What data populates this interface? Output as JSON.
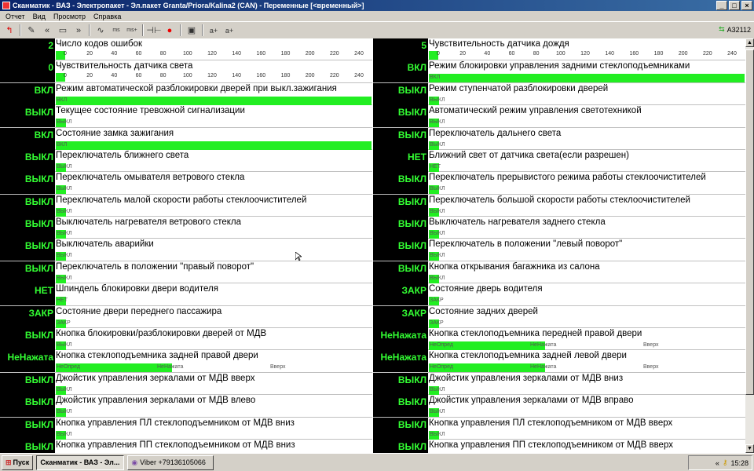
{
  "window": {
    "title": "Сканматик - ВАЗ - Электропакет - Эл.пакет Granta/Priora/Kalina2 (CAN) - Переменные [<временный>]",
    "min": "_",
    "max": "□",
    "close": "×"
  },
  "menu": [
    "Отчет",
    "Вид",
    "Просмотр",
    "Справка"
  ],
  "toolbar": {
    "zoom_small": "ms",
    "zoom_plus": "ms+",
    "a_minus": "a+",
    "a_plus": "a+",
    "adapter": "A32112"
  },
  "scale_ticks": [
    "0",
    "20",
    "40",
    "60",
    "80",
    "100",
    "120",
    "140",
    "160",
    "180",
    "200",
    "220",
    "240"
  ],
  "scale_max": 240,
  "left": [
    {
      "value": "2",
      "label": "Число кодов ошибок",
      "type": "scale"
    },
    {
      "value": "0",
      "label": "Чувствительность датчика света",
      "type": "scale"
    },
    {
      "value": "ВКЛ",
      "label": "Режим автоматической разблокировки дверей при выкл.зажигания",
      "type": "full",
      "bartext": "ВКЛ"
    },
    {
      "value": "ВЫКЛ",
      "label": "Текущее состояние тревожной сигнализации",
      "type": "small",
      "bartext": "ВЫКЛ"
    },
    {
      "value": "ВКЛ",
      "label": "Состояние замка зажигания",
      "type": "full",
      "bartext": "ВКЛ"
    },
    {
      "value": "ВЫКЛ",
      "label": "Переключатель ближнего света",
      "type": "small",
      "bartext": "ВЫКЛ"
    },
    {
      "value": "ВЫКЛ",
      "label": "Переключатель омывателя ветрового стекла",
      "type": "small",
      "bartext": "ВЫКЛ"
    },
    {
      "value": "ВЫКЛ",
      "label": "Переключатель малой скорости работы стеклоочистителей",
      "type": "small",
      "bartext": "ВЫКЛ"
    },
    {
      "value": "ВЫКЛ",
      "label": "Выключатель нагревателя ветрового стекла",
      "type": "small",
      "bartext": "ВЫКЛ"
    },
    {
      "value": "ВЫКЛ",
      "label": "Выключатель аварийки",
      "type": "small",
      "bartext": "ВЫКЛ"
    },
    {
      "value": "ВЫКЛ",
      "label": "Переключатель в положении \"правый поворот\"",
      "type": "small",
      "bartext": "ВЫКЛ"
    },
    {
      "value": "НЕТ",
      "label": "Шпиндель блокировки двери водителя",
      "type": "small",
      "bartext": "НЕТ"
    },
    {
      "value": "ЗАКР",
      "label": "Состояние двери переднего пассажира",
      "type": "small",
      "bartext": "ЗАКР"
    },
    {
      "value": "ВЫКЛ",
      "label": "Кнопка блокировки/разблокировки дверей от МДВ",
      "type": "small",
      "bartext": "ВЫКЛ"
    },
    {
      "value": "НеНажата",
      "label": "Кнопка стеклоподъемника задней правой двери",
      "type": "tri",
      "b1": "НеОпред",
      "b2": "НеНажата",
      "b3": "Вверх"
    },
    {
      "value": "ВЫКЛ",
      "label": "Джойстик управления зеркалами от МДВ вверх",
      "type": "small",
      "bartext": "ВЫКЛ"
    },
    {
      "value": "ВЫКЛ",
      "label": "Джойстик управления зеркалами от МДВ влево",
      "type": "small",
      "bartext": "ВЫКЛ"
    },
    {
      "value": "ВЫКЛ",
      "label": "Кнопка управления ПЛ стеклоподъемником от МДВ вниз",
      "type": "small",
      "bartext": "ВЫКЛ"
    },
    {
      "value": "ВЫКЛ",
      "label": "Кнопка управления ПП стеклоподъемником от МДВ вниз",
      "type": "small",
      "bartext": "ВЫКЛ"
    }
  ],
  "right": [
    {
      "value": "5",
      "label": "Чувствительность датчика дождя",
      "type": "scale"
    },
    {
      "value": "ВКЛ",
      "label": "Режим блокировки управления задними стеклоподъемниками",
      "type": "full",
      "bartext": "ВКЛ"
    },
    {
      "value": "ВЫКЛ",
      "label": "Режим ступенчатой разблокировки дверей",
      "type": "small",
      "bartext": "ВЫКЛ"
    },
    {
      "value": "ВЫКЛ",
      "label": "Автоматический режим управления светотехникой",
      "type": "small",
      "bartext": "ВЫКЛ"
    },
    {
      "value": "ВЫКЛ",
      "label": "Переключатель дальнего света",
      "type": "small",
      "bartext": "ВЫКЛ"
    },
    {
      "value": "НЕТ",
      "label": "Ближний свет от датчика света(если разрешен)",
      "type": "small",
      "bartext": "НЕТ"
    },
    {
      "value": "ВЫКЛ",
      "label": "Переключатель прерывистого режима работы стеклоочистителей",
      "type": "small",
      "bartext": "ВЫКЛ"
    },
    {
      "value": "ВЫКЛ",
      "label": "Переключатель большой скорости работы стеклоочистителей",
      "type": "small",
      "bartext": "ВЫКЛ"
    },
    {
      "value": "ВЫКЛ",
      "label": "Выключатель нагревателя заднего стекла",
      "type": "small",
      "bartext": "ВЫКЛ"
    },
    {
      "value": "ВЫКЛ",
      "label": "Переключатель в положении \"левый поворот\"",
      "type": "small",
      "bartext": "ВЫКЛ"
    },
    {
      "value": "ВЫКЛ",
      "label": "Кнопка открывания багажника из салона",
      "type": "small",
      "bartext": "ВЫКЛ"
    },
    {
      "value": "ЗАКР",
      "label": "Состояние дверь водителя",
      "type": "small",
      "bartext": "ЗАКР"
    },
    {
      "value": "ЗАКР",
      "label": "Состояние задних дверей",
      "type": "small",
      "bartext": "ЗАКР"
    },
    {
      "value": "НеНажата",
      "label": "Кнопка стеклоподъемника передней правой двери",
      "type": "tri",
      "b1": "НеОпред",
      "b2": "НеНажата",
      "b3": "Вверх"
    },
    {
      "value": "НеНажата",
      "label": "Кнопка стеклоподъемника задней левой двери",
      "type": "tri",
      "b1": "НеОпред",
      "b2": "НеНажата",
      "b3": "Вверх"
    },
    {
      "value": "ВЫКЛ",
      "label": "Джойстик управления зеркалами от МДВ вниз",
      "type": "small",
      "bartext": "ВЫКЛ"
    },
    {
      "value": "ВЫКЛ",
      "label": "Джойстик управления зеркалами от МДВ вправо",
      "type": "small",
      "bartext": "ВЫКЛ"
    },
    {
      "value": "ВЫКЛ",
      "label": "Кнопка управления ПЛ стеклоподъемником от МДВ вверх",
      "type": "small",
      "bartext": "ВЫКЛ"
    },
    {
      "value": "ВЫКЛ",
      "label": "Кнопка управления ПП стеклоподъемником от МДВ вверх",
      "type": "small",
      "bartext": "ВЫКЛ"
    }
  ],
  "taskbar": {
    "start": "Пуск",
    "task_active": "Сканматик - ВАЗ - Эл...",
    "task_viber": "Viber +79136105066",
    "clock": "15:28"
  },
  "colors": {
    "value_bg": "#000000",
    "value_text": "#33ff33",
    "bar": "#22ee22"
  }
}
